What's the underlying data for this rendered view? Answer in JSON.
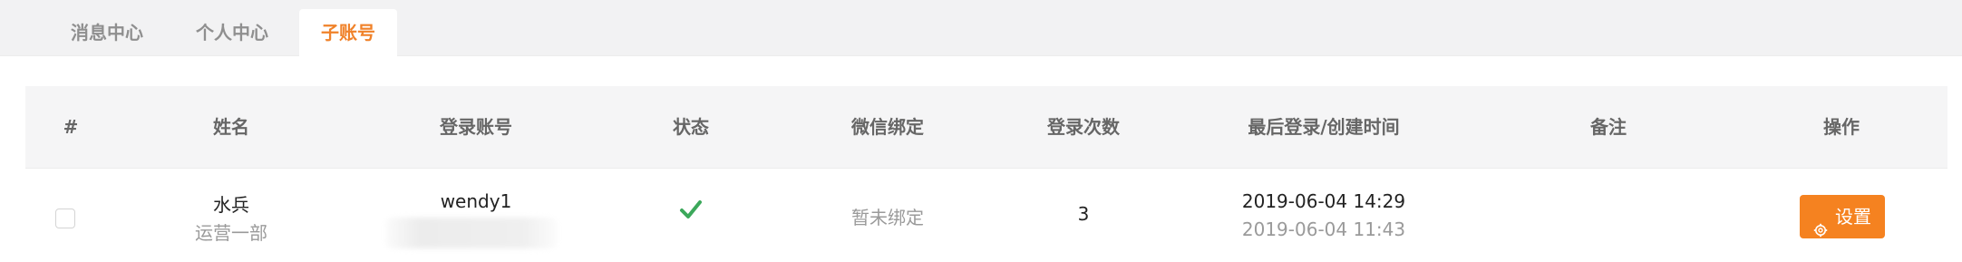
{
  "tabs": [
    {
      "label": "消息中心",
      "active": false
    },
    {
      "label": "个人中心",
      "active": false
    },
    {
      "label": "子账号",
      "active": true
    }
  ],
  "table": {
    "headers": [
      "#",
      "姓名",
      "登录账号",
      "状态",
      "微信绑定",
      "登录次数",
      "最后登录/创建时间",
      "备注",
      "操作"
    ],
    "rows": [
      {
        "name": "水兵",
        "department": "运营一部",
        "account": "wendy1",
        "status_icon": "check-icon",
        "wechat": "暂未绑定",
        "login_count": "3",
        "last_login": "2019-06-04 14:29",
        "created": "2019-06-04 11:43",
        "remark": "",
        "action_label": "设置",
        "action_icon": "gear-icon"
      }
    ]
  },
  "colors": {
    "accent": "#f58220",
    "active_tab": "#f0822a",
    "status_ok": "#3ca85b"
  }
}
